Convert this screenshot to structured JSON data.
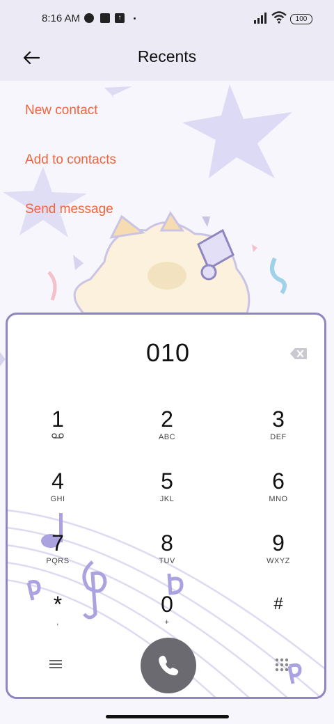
{
  "status_bar": {
    "time": "8:16 AM",
    "icons": [
      "notification-icon-circle",
      "notification-icon-square",
      "upload-icon"
    ],
    "battery": "100"
  },
  "header": {
    "title": "Recents",
    "back_icon": "arrow-left-icon"
  },
  "actions": [
    {
      "label": "New contact"
    },
    {
      "label": "Add to contacts"
    },
    {
      "label": "Send message"
    }
  ],
  "dialer": {
    "number": "010",
    "keys": [
      {
        "digit": "1",
        "letters": ""
      },
      {
        "digit": "2",
        "letters": "ABC"
      },
      {
        "digit": "3",
        "letters": "DEF"
      },
      {
        "digit": "4",
        "letters": "GHI"
      },
      {
        "digit": "5",
        "letters": "JKL"
      },
      {
        "digit": "6",
        "letters": "MNO"
      },
      {
        "digit": "7",
        "letters": "PQRS"
      },
      {
        "digit": "8",
        "letters": "TUV"
      },
      {
        "digit": "9",
        "letters": "WXYZ"
      },
      {
        "digit": "*",
        "letters": ","
      },
      {
        "digit": "0",
        "letters": "+"
      },
      {
        "digit": "#",
        "letters": ""
      }
    ]
  },
  "colors": {
    "accent": "#f0643c",
    "panel_border": "#8e86c0",
    "call_button": "#6b6a70",
    "header_bg": "#ecebf5"
  }
}
